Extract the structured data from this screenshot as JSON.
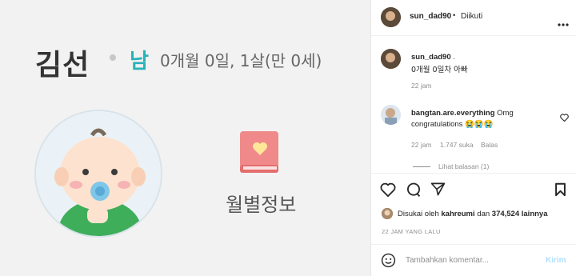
{
  "photo": {
    "name": "김선",
    "gender": "남",
    "age": "0개월 0일, 1살(만 0세)",
    "menu_label": "월별정보"
  },
  "header": {
    "username": "sun_dad90",
    "separator": "•",
    "follow_status": "Diikuti",
    "more_icon": "more-horizontal-icon"
  },
  "caption": {
    "username": "sun_dad90",
    "suffix": " .",
    "text": "0개월 0일차 아빠",
    "time": "22 jam"
  },
  "comment": {
    "username": "bangtan.are.everything",
    "text_start": "Omg",
    "text_line2": "congratulations 😭😭😭",
    "time": "22 jam",
    "likes": "1.747 suka",
    "reply": "Balas",
    "view_replies": "Lihat balasan (1)"
  },
  "likes_line": {
    "prefix": "Disukai oleh ",
    "user": "kahreumi",
    "middle": " dan ",
    "count": "374,524 lainnya"
  },
  "timestamp": "22 JAM YANG LALU",
  "composer": {
    "placeholder": "Tambahkan komentar...",
    "post_label": "Kirim"
  },
  "colors": {
    "accent_teal": "#27b3b8",
    "link_blue": "#0095f6",
    "menu_pink": "#f08a8a"
  }
}
